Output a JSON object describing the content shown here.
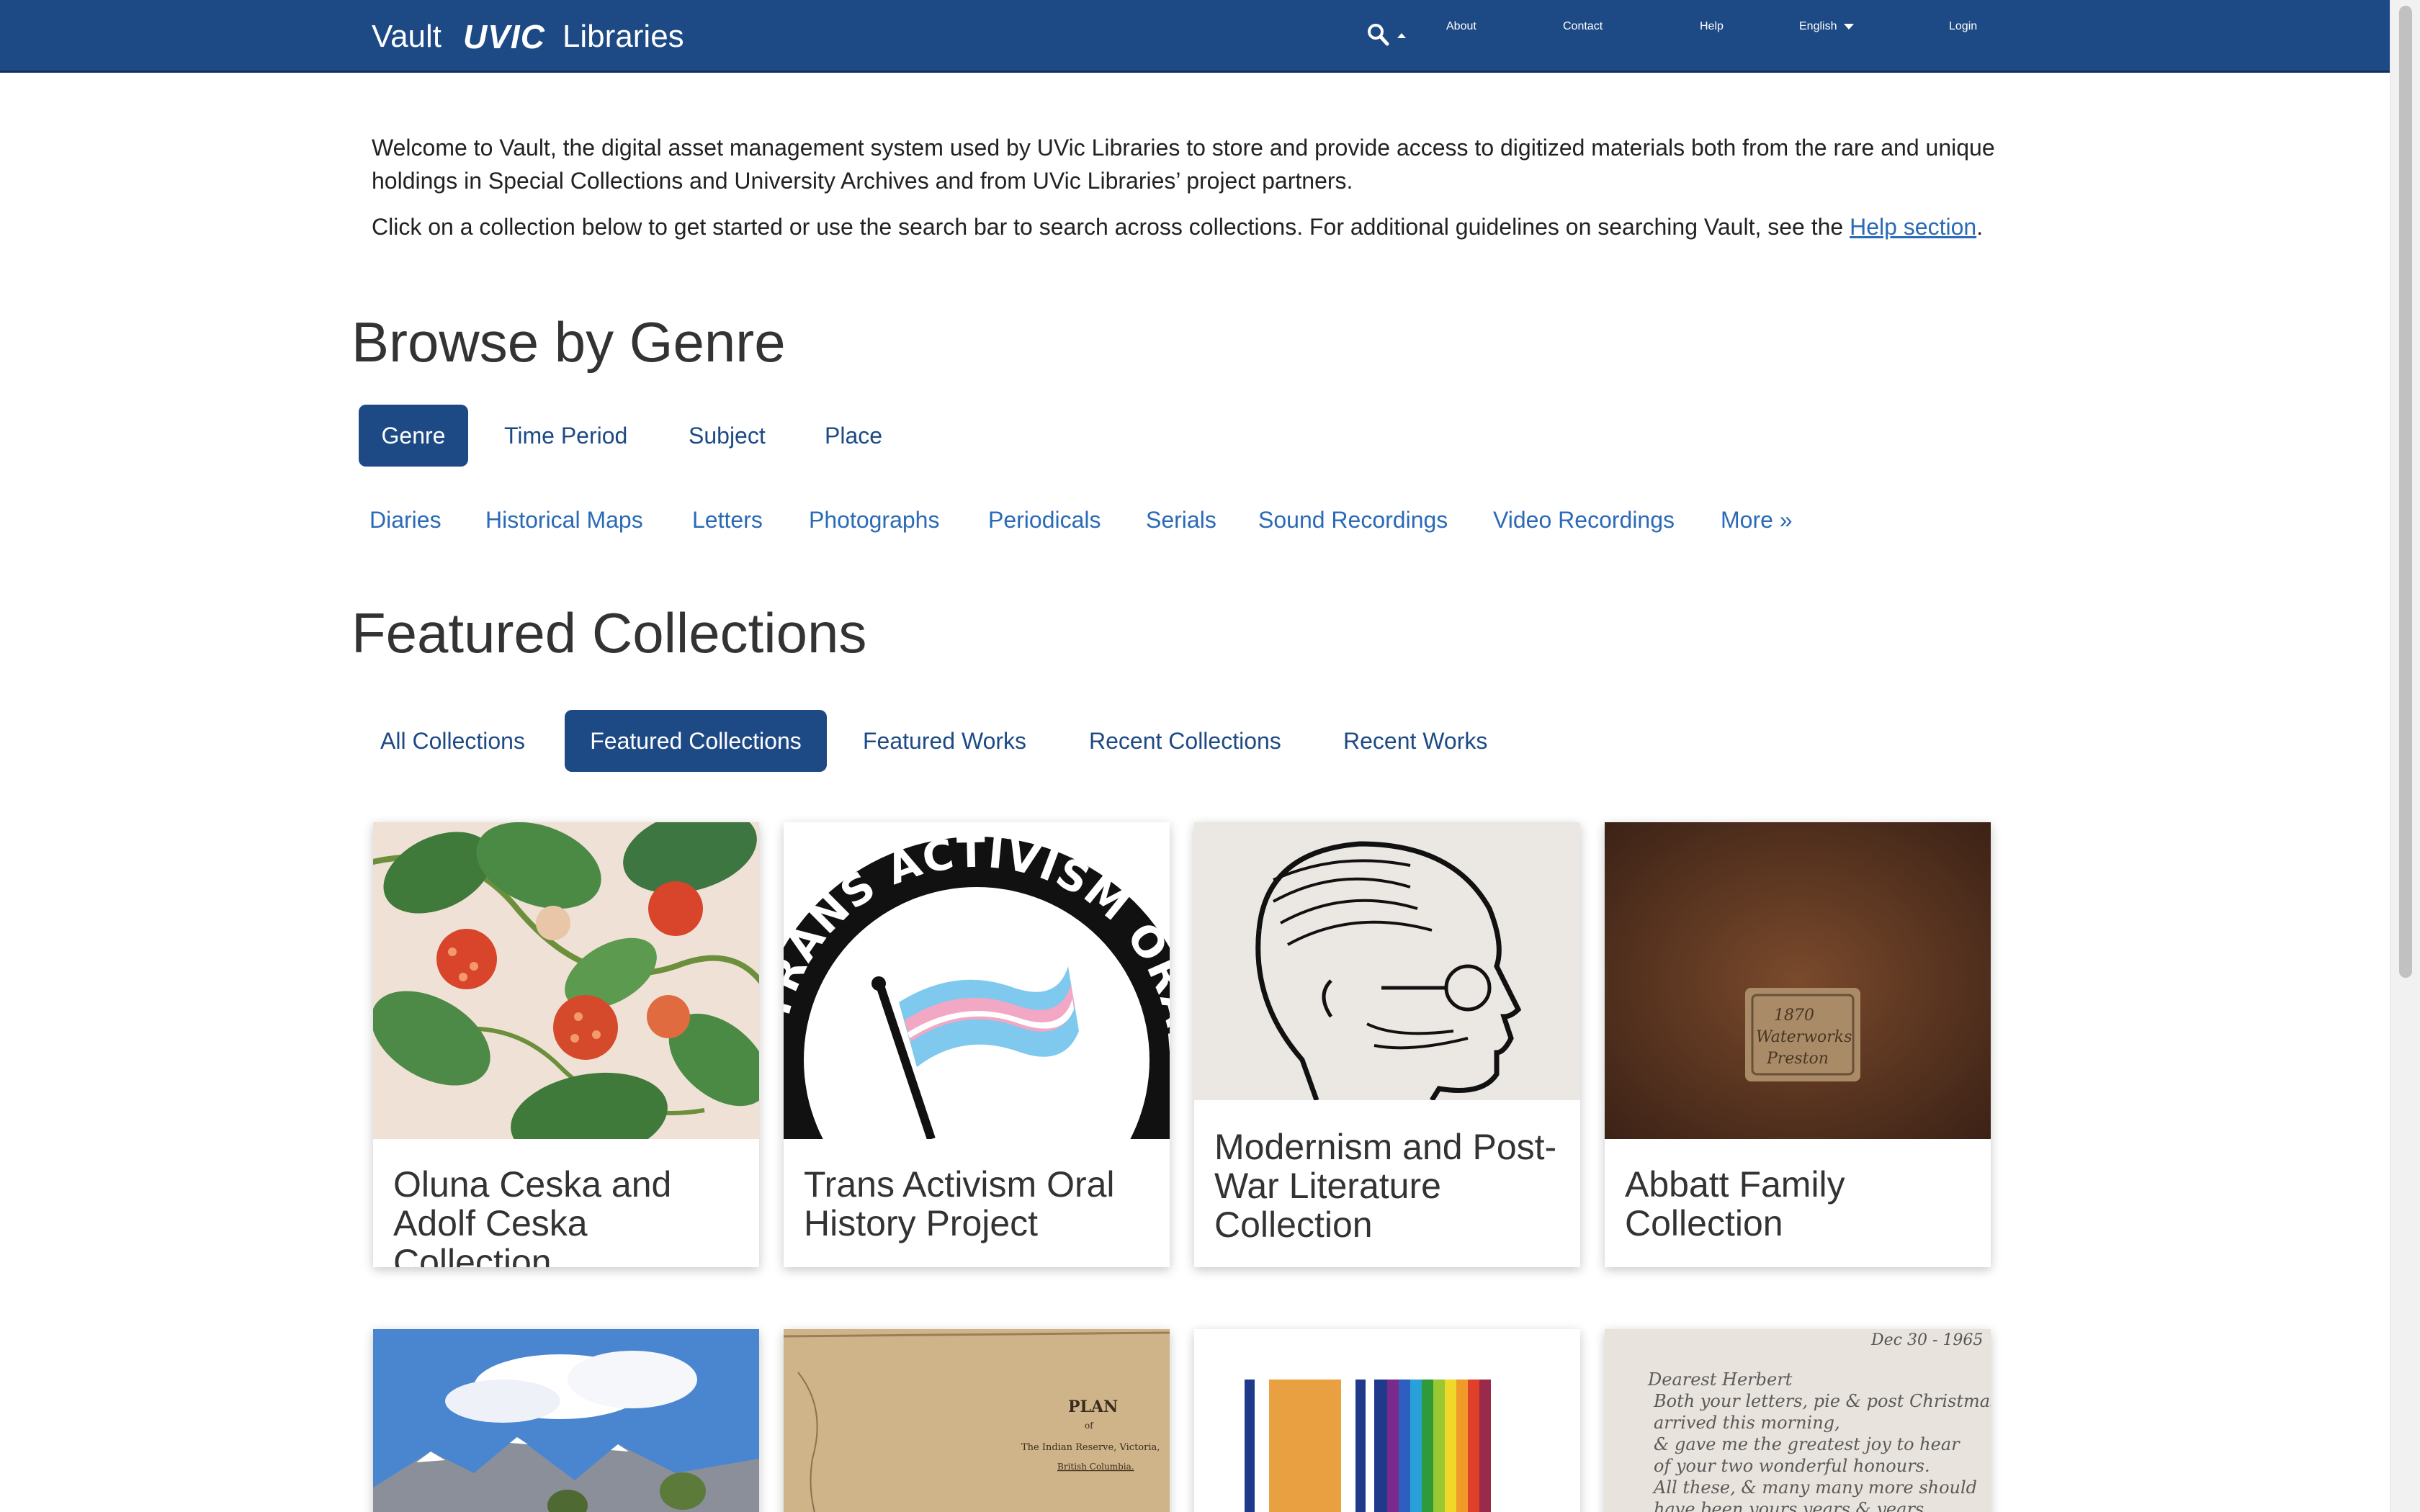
{
  "navbar": {
    "brand_vault": "Vault",
    "brand_uvic": "UVIC",
    "brand_libraries": "Libraries",
    "about": "About",
    "contact": "Contact",
    "help": "Help",
    "language": "English",
    "login": "Login"
  },
  "intro": {
    "p1": "Welcome to Vault, the digital asset management system used by UVic Libraries to store and provide access to digitized materials both from the rare and unique holdings in Special Collections and University Archives and from UVic Libraries’ project partners.",
    "p2_text": "Click on a collection below to get started or use the search bar to search across collections. For additional guidelines on searching Vault, see the ",
    "p2_link": "Help section",
    "p2_end": "."
  },
  "browse": {
    "heading": "Browse by Genre",
    "tabs": [
      "Genre",
      "Time Period",
      "Subject",
      "Place"
    ],
    "genres": [
      "Diaries",
      "Historical Maps",
      "Letters",
      "Photographs",
      "Periodicals",
      "Serials",
      "Sound Recordings",
      "Video Recordings",
      "More »"
    ]
  },
  "featured": {
    "heading": "Featured Collections",
    "tabs": [
      "All Collections",
      "Featured Collections",
      "Featured Works",
      "Recent Collections",
      "Recent Works"
    ],
    "cards": [
      {
        "title": "Oluna Ceska and Adolf Ceska Collection"
      },
      {
        "title": "Trans Activism Oral History Project"
      },
      {
        "title": "Modernism and Post-War Literature Collection"
      },
      {
        "title": "Abbatt Family Collection"
      }
    ],
    "thumb_text": {
      "trans_ring": "TRANS ACTIVISM ORAL HISTORY PROJECT",
      "label_line1": "1870",
      "label_line2": "Waterworks",
      "label_line3": "Preston",
      "map_title": "PLAN",
      "map_of": "of",
      "map_line": "The Indian Reserve, Victoria,",
      "map_line2": "British Columbia.",
      "letter_date": "Dec 30 - 1965",
      "letter_lines": [
        "Dearest Herbert",
        "Both your letters, pie & post Christmas",
        "arrived this morning,",
        "& gave me the greatest joy to hear",
        "of your two wonderful honours.",
        "All these, & many many more should",
        "have been yours years & years"
      ]
    }
  }
}
